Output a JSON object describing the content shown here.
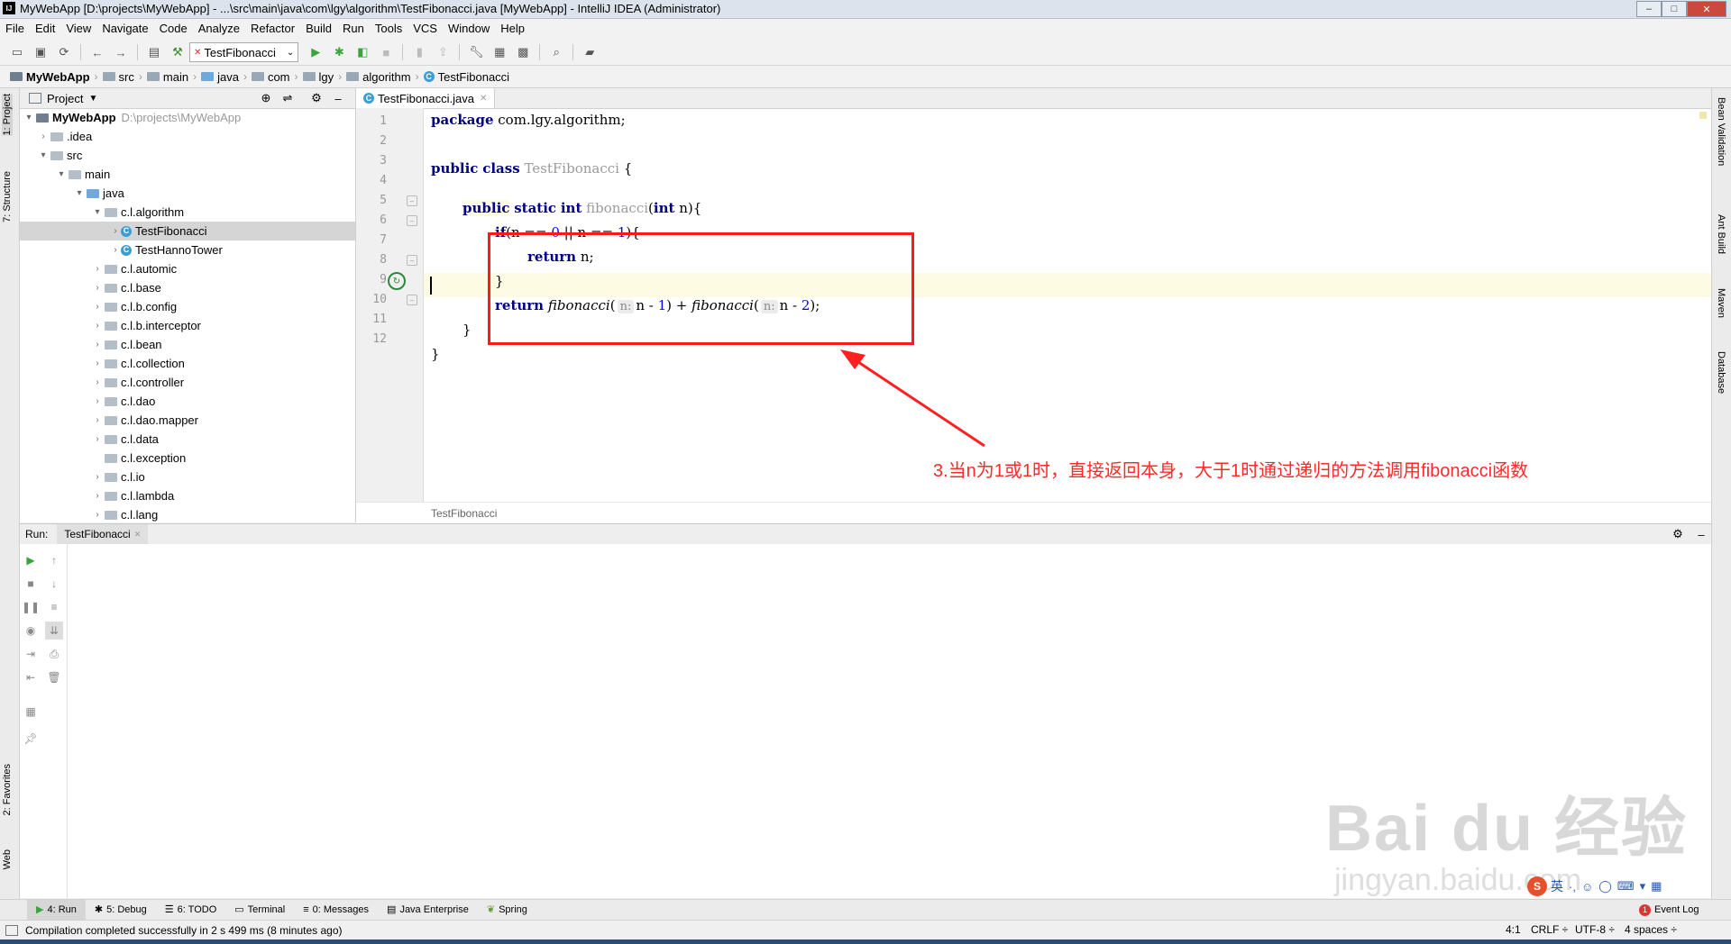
{
  "window": {
    "title": "MyWebApp [D:\\projects\\MyWebApp] - ...\\src\\main\\java\\com\\lgy\\algorithm\\TestFibonacci.java [MyWebApp] - IntelliJ IDEA (Administrator)",
    "app_icon": "IJ"
  },
  "menu": [
    "File",
    "Edit",
    "View",
    "Navigate",
    "Code",
    "Analyze",
    "Refactor",
    "Build",
    "Run",
    "Tools",
    "VCS",
    "Window",
    "Help"
  ],
  "toolbar": {
    "run_config": "TestFibonacci"
  },
  "breadcrumb": [
    "MyWebApp",
    "src",
    "main",
    "java",
    "com",
    "lgy",
    "algorithm",
    "TestFibonacci"
  ],
  "left_strip": {
    "project": "1: Project",
    "structure": "7: Structure",
    "favorites": "2: Favorites",
    "web": "Web"
  },
  "right_strip": [
    "Bean Validation",
    "Ant Build",
    "Maven",
    "Database"
  ],
  "project_panel": {
    "title": "Project",
    "root": {
      "name": "MyWebApp",
      "path": "D:\\projects\\MyWebApp"
    },
    "items": [
      ".idea",
      "src",
      "main",
      "java",
      "c.l.algorithm",
      "TestFibonacci",
      "TestHannoTower",
      "c.l.automic",
      "c.l.base",
      "c.l.b.config",
      "c.l.b.interceptor",
      "c.l.bean",
      "c.l.collection",
      "c.l.controller",
      "c.l.dao",
      "c.l.dao.mapper",
      "c.l.data",
      "c.l.exception",
      "c.l.io",
      "c.l.lambda",
      "c.l.lang"
    ]
  },
  "editor": {
    "tab": "TestFibonacci.java",
    "line_numbers": [
      "1",
      "2",
      "3",
      "4",
      "5",
      "6",
      "7",
      "8",
      "9",
      "10",
      "11",
      "12"
    ],
    "code": {
      "l1_kw": "package",
      "l1_rest": " com.lgy.algorithm;",
      "l3_kw1": "public",
      "l3_kw2": "class",
      "l3_name": "TestFibonacci",
      "l3_rest": " {",
      "l5_kw1": "public",
      "l5_kw2": "static",
      "l5_kw3": "int",
      "l5_name": "fibonacci",
      "l5_p1": "(",
      "l5_kw4": "int",
      "l5_p2": " n){",
      "l6_kw": "if",
      "l6_a": "(n == ",
      "l6_n0": "0",
      "l6_b": " || n == ",
      "l6_n1": "1",
      "l6_c": "){",
      "l7_kw": "return",
      "l7_rest": " n;",
      "l8": "}",
      "l9_kw": "return",
      "l9_f1": "fibonacci",
      "l9_p1": "(",
      "l9_h1": "n:",
      "l9_a1": "n - ",
      "l9_n1": "1",
      "l9_c1": ") + ",
      "l9_f2": "fibonacci",
      "l9_p2": "(",
      "l9_h2": "n:",
      "l9_a2": "n - ",
      "l9_n2": "2",
      "l9_c2": ");",
      "l10": "}",
      "l11": "}"
    },
    "footer": "TestFibonacci"
  },
  "run_panel": {
    "label": "Run:",
    "tab": "TestFibonacci"
  },
  "bottom_tabs": [
    "4: Run",
    "5: Debug",
    "6: TODO",
    "Terminal",
    "0: Messages",
    "Java Enterprise",
    "Spring"
  ],
  "event_log": {
    "count": "1",
    "label": "Event Log"
  },
  "status": {
    "message": "Compilation completed successfully in 2 s 499 ms (8 minutes ago)",
    "position": "4:1",
    "line_sep": "CRLF ÷",
    "encoding": "UTF-8 ÷",
    "indent": "4 spaces ÷"
  },
  "annotation": "3.当n为1或1时，直接返回本身，大于1时通过递归的方法调用fibonacci函数",
  "watermark": {
    "main": "Bai du 经验",
    "sub": "jingyan.baidu.com"
  },
  "ime_label": "英"
}
